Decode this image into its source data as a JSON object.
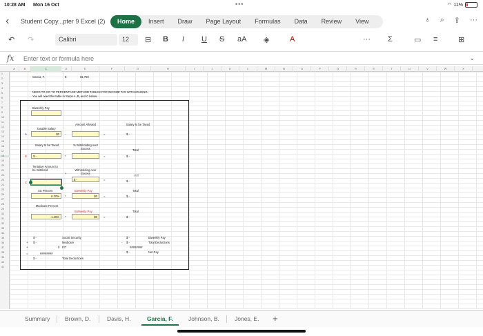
{
  "status": {
    "time": "10:28 AM",
    "date": "Mon 16 Oct",
    "battery": "11%"
  },
  "ribbon": {
    "doc_title": "Student Copy...pter 9 Excel (2)",
    "tabs": [
      "Home",
      "Insert",
      "Draw",
      "Page Layout",
      "Formulas",
      "Data",
      "Review",
      "View"
    ],
    "active_tab": "Home"
  },
  "toolbar": {
    "font": "Calibri",
    "size": "12",
    "bold": "B",
    "italic": "I",
    "underline": "U",
    "strike": "S",
    "fontsize_aa": "aA"
  },
  "formula_bar": {
    "fx": "fx",
    "placeholder": "Enter text or formula here"
  },
  "sheet": {
    "columns": [
      "A",
      "B",
      "C",
      "D",
      "E",
      "F",
      "G",
      "H",
      "I",
      "J",
      "K",
      "L",
      "M",
      "N",
      "O",
      "P",
      "Q",
      "R",
      "S",
      "T",
      "U",
      "V",
      "W",
      "X"
    ],
    "row_numbers": [
      "1",
      "2",
      "3",
      "4",
      "5",
      "6",
      "7",
      "8",
      "9",
      "10",
      "11",
      "12",
      "13",
      "14",
      "15",
      "16",
      "17",
      "18",
      "19",
      "20",
      "21",
      "22",
      "23",
      "24",
      "25",
      "26",
      "27",
      "28",
      "29",
      "30",
      "31",
      "32",
      "33",
      "34",
      "35",
      "36",
      "37",
      "38",
      "39",
      "40",
      "41"
    ],
    "header_name": "Garcia, F.",
    "header_dollar": "$",
    "header_amount": "$1,750",
    "instruction1": "NEED TO GO TO PERCENTAGE METHOD TABLES FOR INCOME TAX WITHHOLDING.",
    "instruction2": "You will need this table in Steps A, B, and C below:",
    "biweekly_pay": "Biweekly Pay",
    "taxable_salary": "Taxable Salary",
    "taxable_salary_value": "$0",
    "amount_allowed": "Amount Allowed",
    "salary_to_be_taxed_right": "Salary to be Taxed",
    "step_a": "A",
    "step_b": "B",
    "step_c": "C",
    "minus": "-",
    "equals": "=",
    "dollar_dash": "$      -",
    "salary_to_be_taxed": "Salary to be Taxed",
    "pct_withholding": "% Withholding over Excess",
    "total": "Total",
    "tentative": "Tentative Amount to be Withheld",
    "plus": "+",
    "withholding_over_excess": "Withholding over Excess",
    "fit": "FIT",
    "ss_percent": "SS Percent",
    "ss_percent_value": "6.20%",
    "times": "*",
    "biweekly_pay_red": "BiWeekly Pay",
    "zero_dollars": "$0",
    "medicare_percent": "Medicare Percent",
    "medicare_value": "1.45%",
    "social_security": "Social Security",
    "medicare": "Medicare",
    "zero": "0",
    "fit_short": "FIT",
    "hashes": "########",
    "total_deductions": "Total Deductions",
    "biweekly_pay_sum": "Biweekly Pay",
    "total_deductions_sum": "Total Deductions",
    "net_pay": "Net Pay"
  },
  "sheet_tabs": [
    "Summary",
    "Brown, D.",
    "Davis, H.",
    "Garcia, F.",
    "Johnson, B.",
    "Jones, E."
  ],
  "active_sheet": "Garcia, F.",
  "colors": {
    "accent": "#1e7145",
    "input_fill": "#fff9c7",
    "warning_red": "#d33"
  }
}
